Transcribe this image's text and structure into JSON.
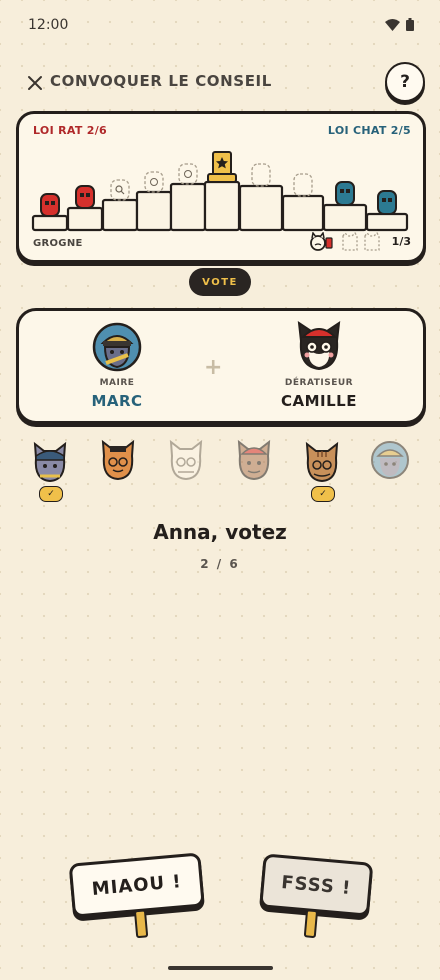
{
  "status_bar": {
    "time": "12:00"
  },
  "header": {
    "title": "CONVOQUER LE CONSEIL",
    "help_label": "?"
  },
  "board": {
    "rat_law": "LOI RAT 2/6",
    "cat_law": "LOI CHAT 2/5",
    "grogne_label": "GROGNE",
    "grogne_count": "1/3"
  },
  "vote_badge": "VOTE",
  "government": {
    "mayor_role": "MAIRE",
    "mayor_name": "MARC",
    "ratcatcher_role": "DÉRATISEUR",
    "ratcatcher_name": "CAMILLE"
  },
  "players": [
    {
      "icon": "cat-avatar-gray-cap",
      "voted": true,
      "dimmed": false
    },
    {
      "icon": "cat-avatar-orange-glasses",
      "voted": false,
      "dimmed": false
    },
    {
      "icon": "cat-avatar-outline",
      "voted": false,
      "dimmed": true
    },
    {
      "icon": "cat-avatar-red-beret",
      "voted": false,
      "dimmed": true
    },
    {
      "icon": "cat-avatar-tabby",
      "voted": true,
      "dimmed": false
    },
    {
      "icon": "cat-avatar-blue-round",
      "voted": false,
      "dimmed": true
    }
  ],
  "prompt": "Anna, votez",
  "progress": "2 / 6",
  "actions": {
    "yes_label": "MIAOU !",
    "no_label": "FSSS !"
  },
  "colors": {
    "rat": "#b0292a",
    "cat": "#27627a",
    "accent": "#f0c04a",
    "ink": "#241f1c",
    "background": "#f7eedb"
  }
}
